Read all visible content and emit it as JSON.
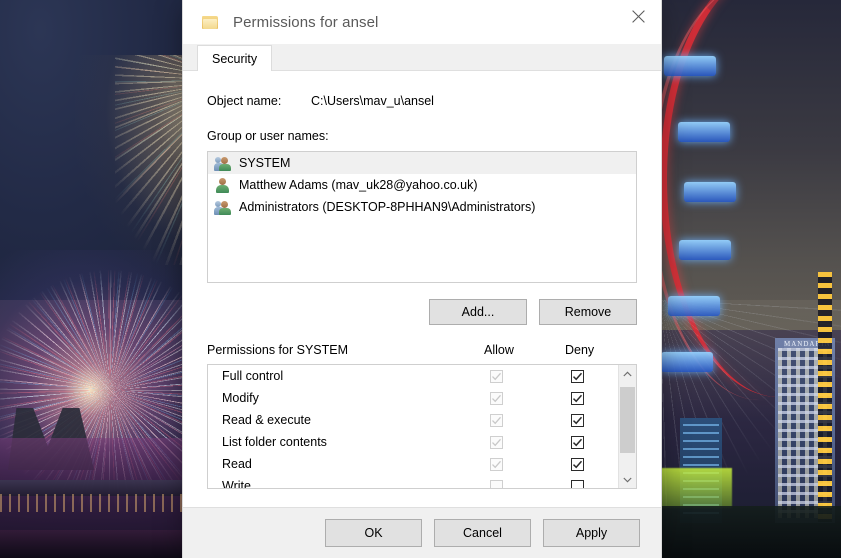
{
  "window": {
    "title": "Permissions for ansel",
    "folder_icon": "folder-icon",
    "close_icon": "close-icon"
  },
  "tabs": [
    {
      "label": "Security",
      "selected": true
    }
  ],
  "object": {
    "label": "Object name:",
    "value": "C:\\Users\\mav_u\\ansel"
  },
  "group_section": {
    "label": "Group or user names:",
    "entries": [
      {
        "name": "SYSTEM",
        "icon": "users-group-icon",
        "selected": true
      },
      {
        "name": "Matthew Adams (mav_uk28@yahoo.co.uk)",
        "icon": "user-icon",
        "selected": false
      },
      {
        "name": "Administrators (DESKTOP-8PHHAN9\\Administrators)",
        "icon": "users-group-icon",
        "selected": false
      }
    ],
    "add_button": "Add...",
    "remove_button": "Remove"
  },
  "permissions": {
    "title": "Permissions for SYSTEM",
    "allow_header": "Allow",
    "deny_header": "Deny",
    "rows": [
      {
        "label": "Full control",
        "allow": true,
        "allow_disabled": true,
        "deny": true
      },
      {
        "label": "Modify",
        "allow": true,
        "allow_disabled": true,
        "deny": true
      },
      {
        "label": "Read & execute",
        "allow": true,
        "allow_disabled": true,
        "deny": true
      },
      {
        "label": "List folder contents",
        "allow": true,
        "allow_disabled": true,
        "deny": true
      },
      {
        "label": "Read",
        "allow": true,
        "allow_disabled": true,
        "deny": true
      },
      {
        "label": "Write",
        "allow": false,
        "allow_disabled": true,
        "deny": false
      }
    ],
    "scrollbar": {
      "up_icon": "chevron-up-icon",
      "down_icon": "chevron-down-icon"
    }
  },
  "footer": {
    "ok": "OK",
    "cancel": "Cancel",
    "apply": "Apply"
  },
  "desktop": {
    "tower_sign": "MANDARIN"
  },
  "colors": {
    "dialog_bg": "#ffffff",
    "chrome_bg": "#f0f0f0",
    "button_bg": "#e1e1e1",
    "button_border": "#adadad",
    "selection_bg": "#f0f0f0",
    "title_text": "#5a5a5a",
    "deny_check": "#2b2b2b",
    "allow_check": "#c8c8c8"
  }
}
